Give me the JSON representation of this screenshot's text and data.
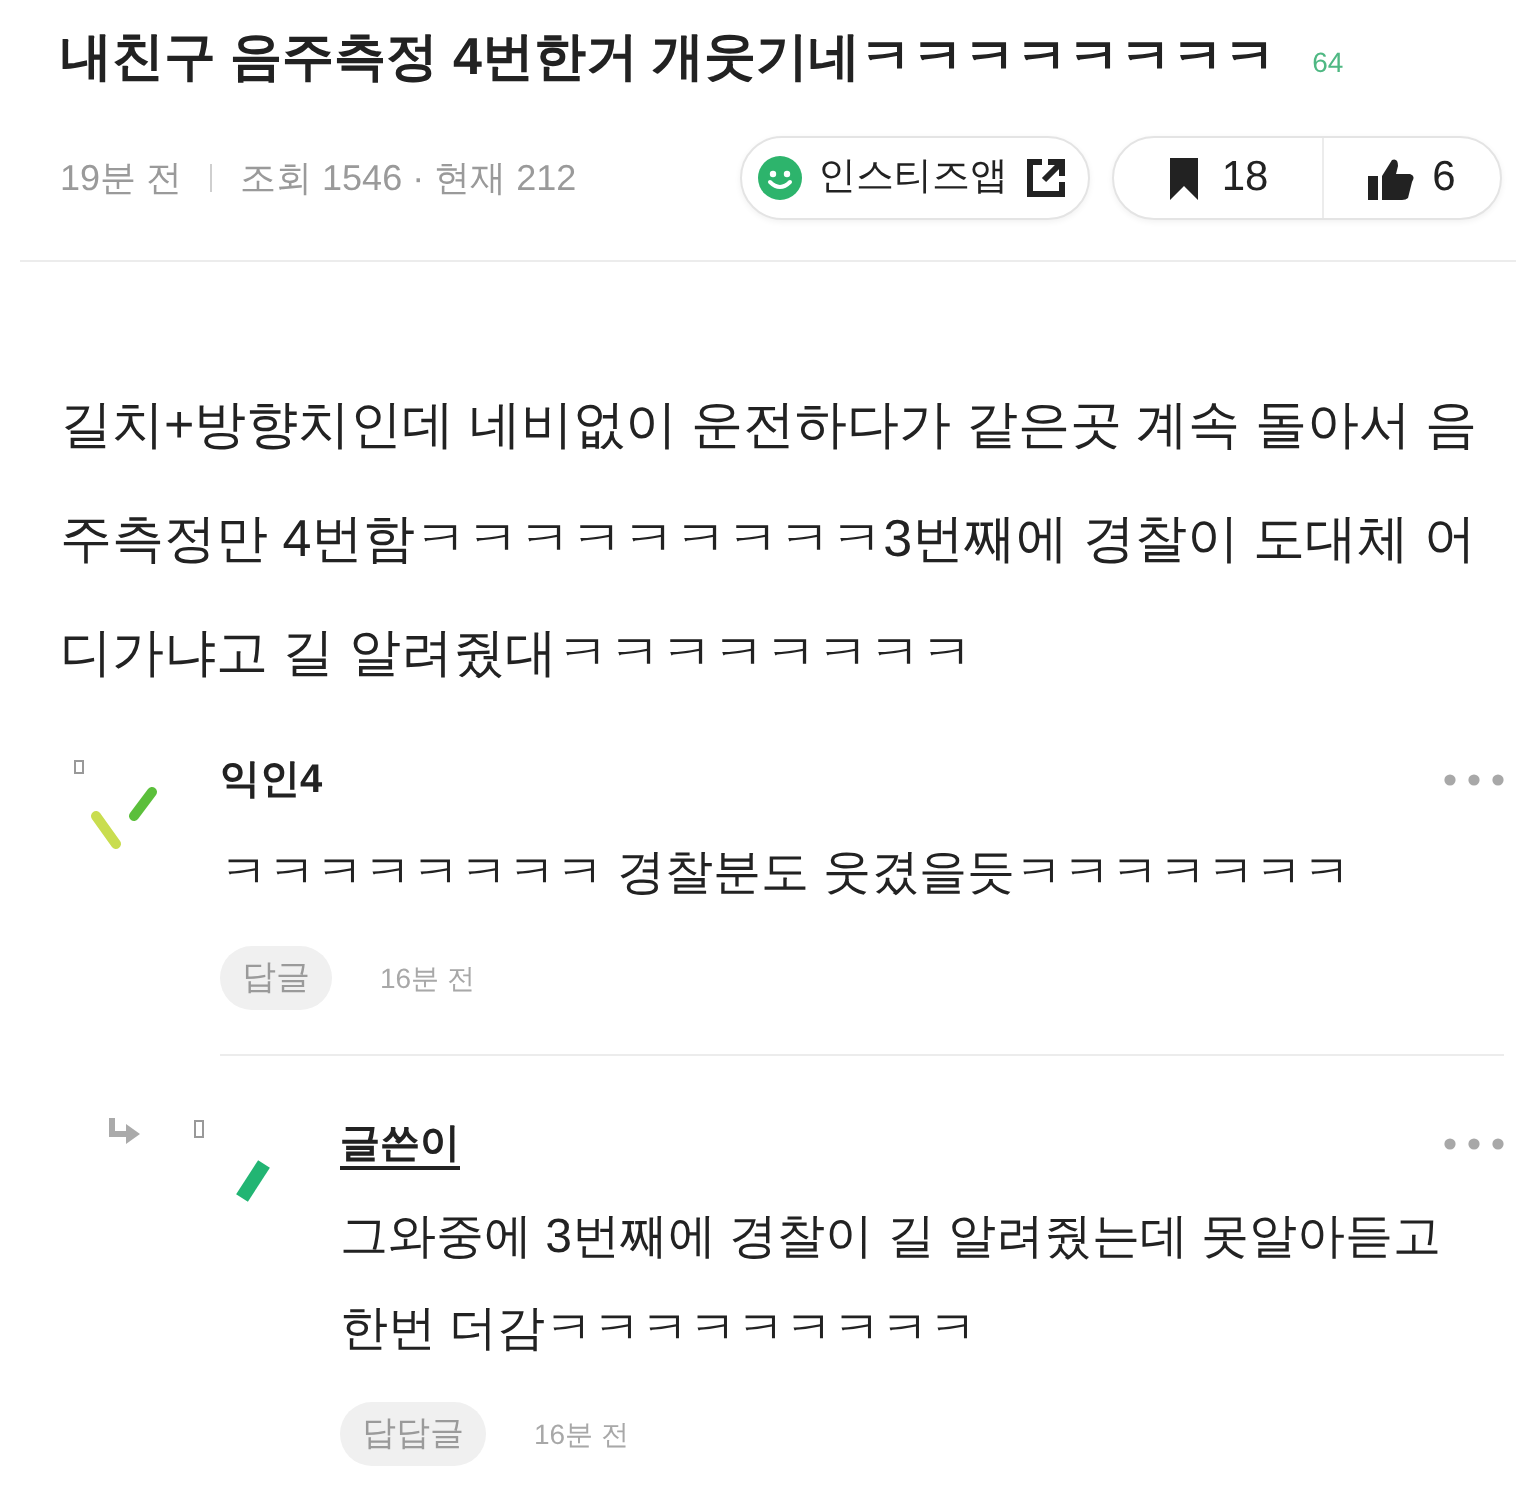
{
  "post": {
    "title": "내친구 음주측정 4번한거 개웃기네ㅋㅋㅋㅋㅋㅋㅋㅋ",
    "comment_count": "64",
    "time": "19분 전",
    "stats": "조회 1546 · 현재 212",
    "app_link": "인스티즈앱",
    "bookmarks": "18",
    "likes": "6",
    "body": "길치+방향치인데 네비없이 운전하다가 같은곳 계속 돌아서 음주측정만 4번함ㅋㅋㅋㅋㅋㅋㅋㅋㅋ3번째에 경찰이 도대체 어디가냐고 길 알려줬대ㅋㅋㅋㅋㅋㅋㅋㅋ"
  },
  "comments": [
    {
      "kind": "comment",
      "author": "익인4",
      "op": false,
      "text": "ㅋㅋㅋㅋㅋㅋㅋㅋ 경찰분도 웃겼을듯ㅋㅋㅋㅋㅋㅋㅋ",
      "reply_button": "답글",
      "time": "16분 전"
    },
    {
      "kind": "reply",
      "author": "글쓴이",
      "op": true,
      "text": "그와중에 3번째에 경찰이 길 알려줬는데 못알아듣고 한번 더감ㅋㅋㅋㅋㅋㅋㅋㅋㅋ",
      "reply_button": "답답글",
      "time": "16분 전"
    }
  ]
}
